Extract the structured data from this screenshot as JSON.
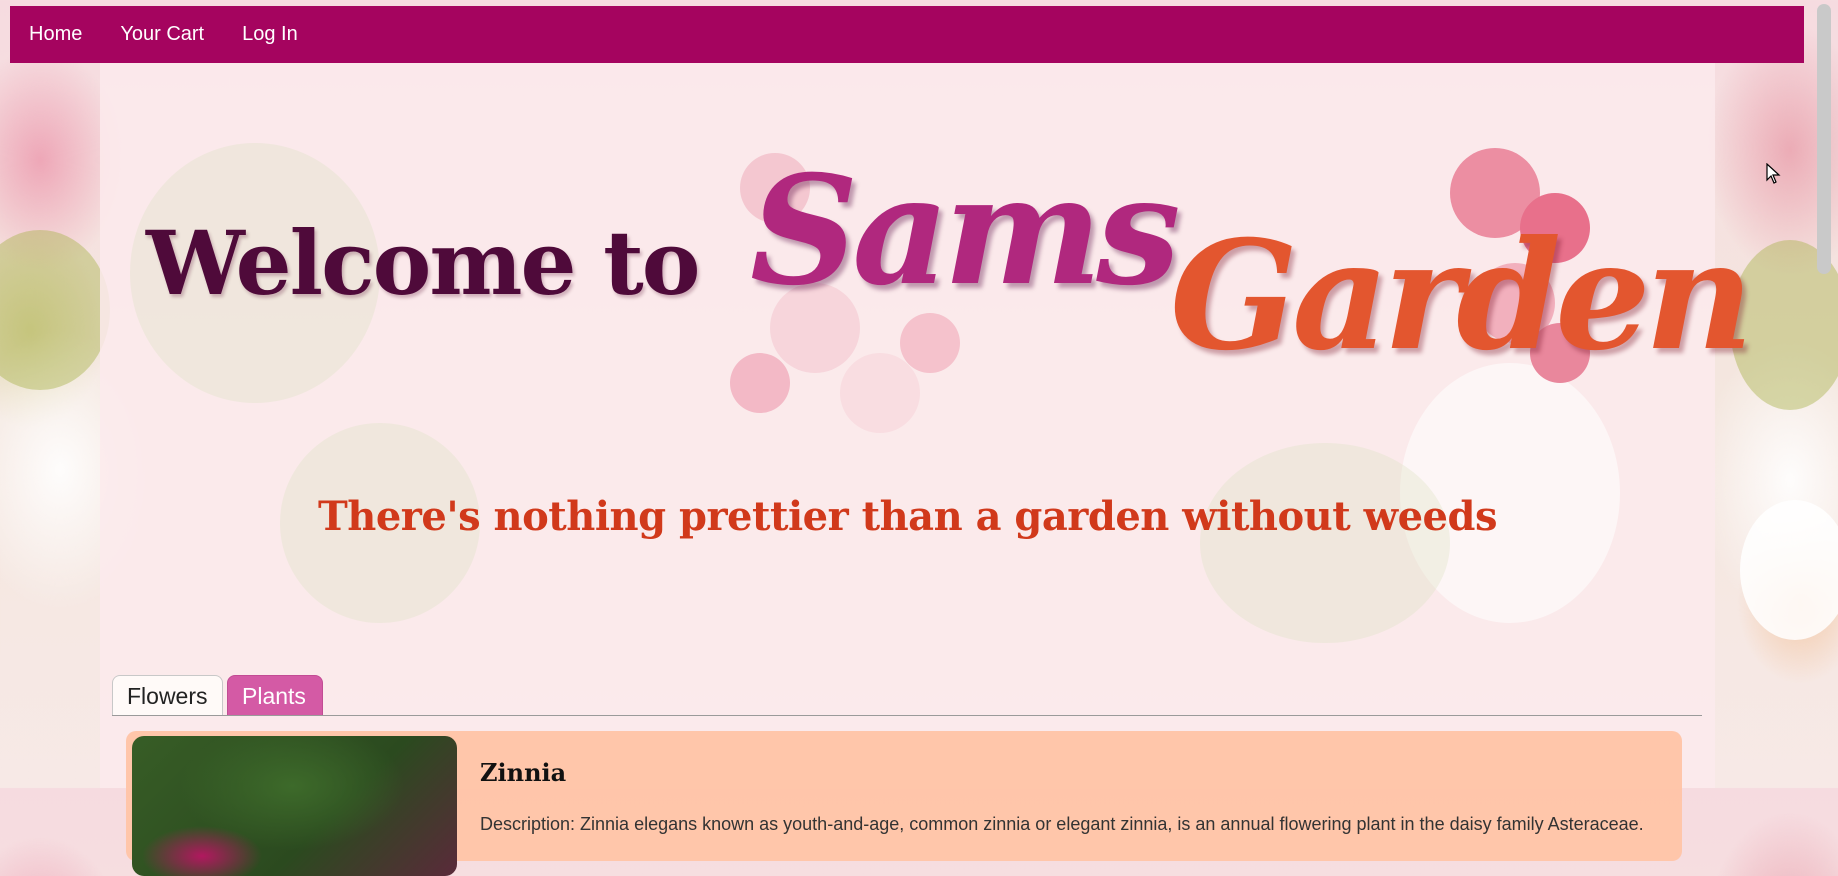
{
  "nav": {
    "items": [
      {
        "label": "Home"
      },
      {
        "label": "Your Cart"
      },
      {
        "label": "Log In"
      }
    ]
  },
  "banner": {
    "welcome": "Welcome to",
    "logo_word1": "Sams",
    "logo_word2": "Garden"
  },
  "tagline": "There's nothing prettier than a garden without weeds",
  "tabs": [
    {
      "label": "Flowers",
      "active": true
    },
    {
      "label": "Plants",
      "active": false
    }
  ],
  "products": [
    {
      "name": "Zinnia",
      "description": "Description: Zinnia elegans known as youth-and-age, common zinnia or elegant zinnia, is an annual flowering plant in the daisy family Asteraceae.",
      "image_icon": "zinnia-photo"
    }
  ],
  "colors": {
    "navbar": "#a5045f",
    "tagline": "#d1391b",
    "tab_inactive": "#d45aa5",
    "card": "#ffc4a6"
  }
}
